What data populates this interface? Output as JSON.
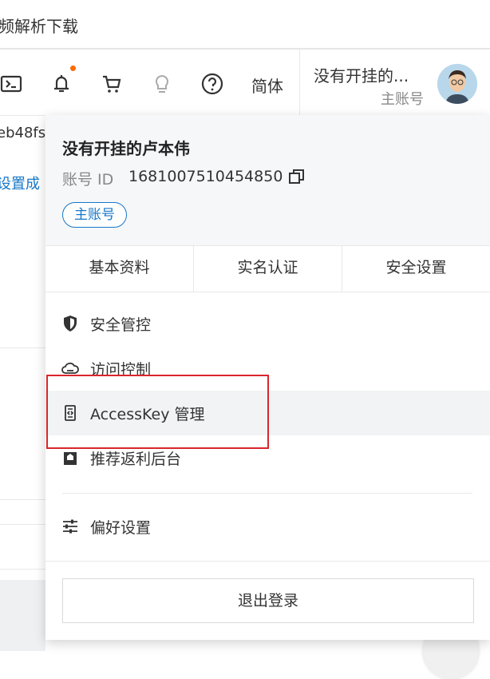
{
  "page_title_fragment": "频解析下载",
  "toolbar": {
    "language": "简体",
    "account_name": "没有开挂的...",
    "account_role": "主账号",
    "notification_dot_color": "#ff6a00",
    "icons": [
      "terminal-icon",
      "bell-icon",
      "cart-icon",
      "lightbulb-icon",
      "help-icon"
    ]
  },
  "background": {
    "text1": "eb48fs",
    "text2": "设置成"
  },
  "panel": {
    "user_name": "没有开挂的卢本伟",
    "id_label": "账号 ID",
    "id_value": "1681007510454850",
    "badge": "主账号",
    "tabs": [
      "基本资料",
      "实名认证",
      "安全设置"
    ],
    "menu": [
      {
        "label": "安全管控",
        "icon": "shield-icon"
      },
      {
        "label": "访问控制",
        "icon": "cloud-icon"
      },
      {
        "label": "AccessKey 管理",
        "icon": "accesskey-icon"
      },
      {
        "label": "推荐返利后台",
        "icon": "rebate-icon"
      },
      {
        "label": "偏好设置",
        "icon": "sliders-icon"
      }
    ],
    "logout": "退出登录"
  },
  "accent_color": "#1677c8",
  "highlight_color": "#d9262c"
}
